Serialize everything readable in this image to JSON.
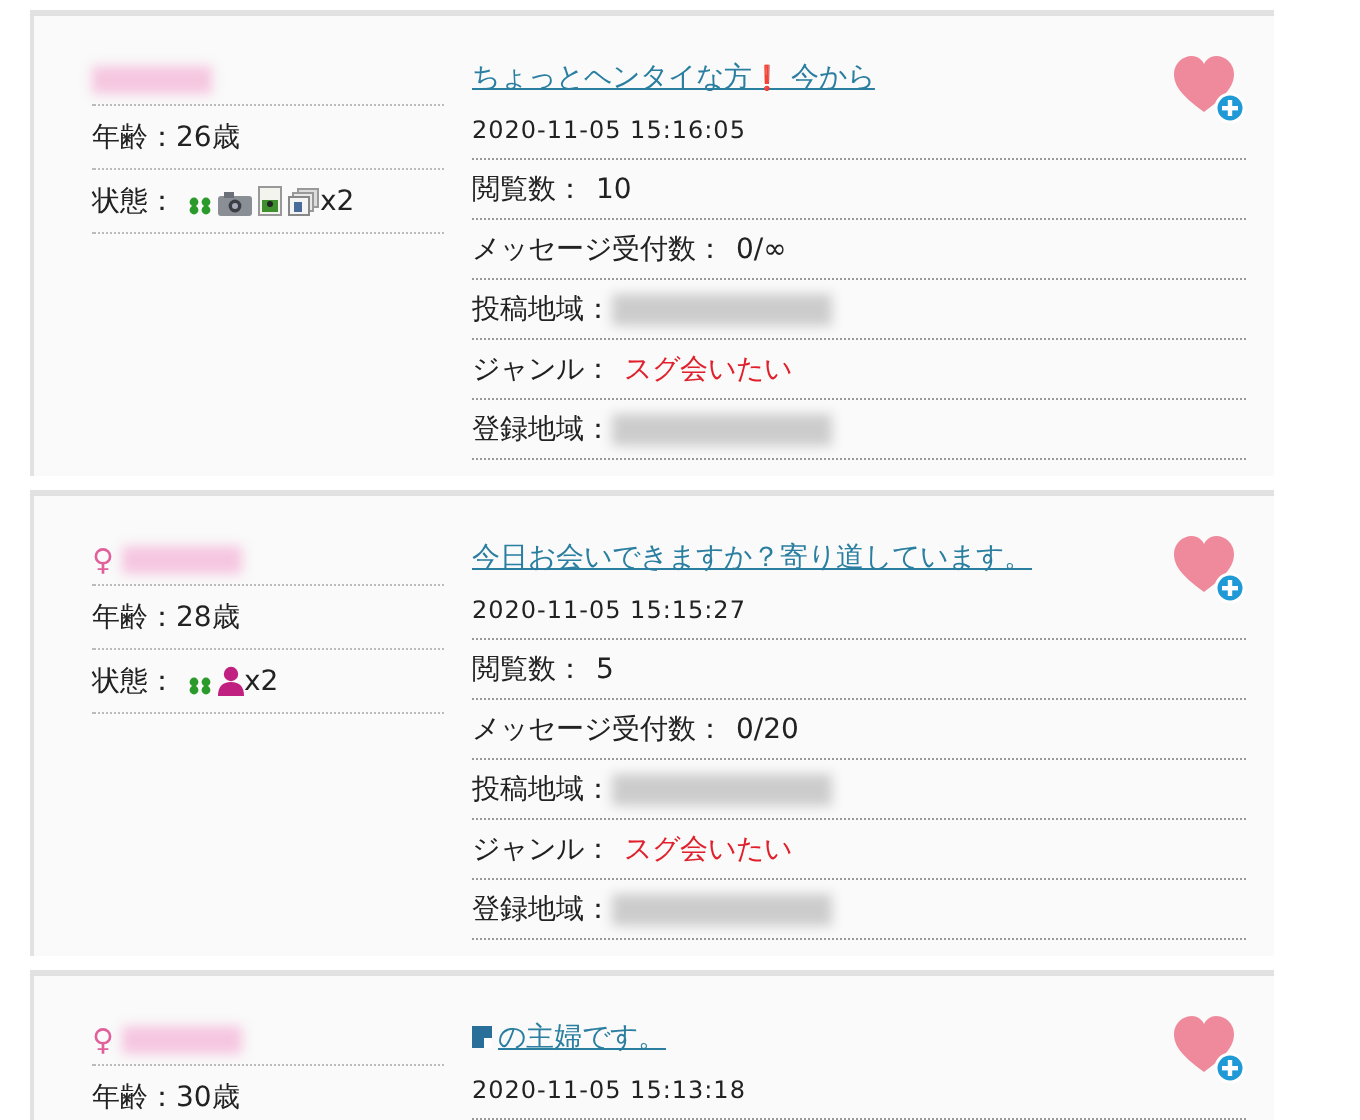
{
  "posts": [
    {
      "title": "ちょっとヘンタイな方",
      "title_mark": "❗",
      "title_suffix": "今から",
      "time": "2020-11-05 15:16:05",
      "age_label": "年齢：",
      "age": "26歳",
      "status_label": "状態：",
      "status_icons": [
        {
          "kind": "clover"
        },
        {
          "kind": "camera"
        },
        {
          "kind": "photo"
        },
        {
          "kind": "photos"
        }
      ],
      "status_count": "x2",
      "rows": [
        {
          "label": "閲覧数：",
          "value": "10",
          "kind": "text"
        },
        {
          "label": "メッセージ受付数：",
          "value": "0/∞",
          "kind": "text"
        },
        {
          "label": "投稿地域：",
          "kind": "blurred"
        },
        {
          "label": "ジャンル：",
          "value": "スグ会いたい",
          "kind": "genre"
        },
        {
          "label": "登録地域：",
          "kind": "blurred"
        }
      ]
    },
    {
      "gender": "♀",
      "title": "今日お会いできますか？寄り道しています。",
      "time": "2020-11-05 15:15:27",
      "age_label": "年齢：",
      "age": "28歳",
      "status_label": "状態：",
      "status_icons": [
        {
          "kind": "clover"
        },
        {
          "kind": "person"
        }
      ],
      "status_count": "x2",
      "rows": [
        {
          "label": "閲覧数：",
          "value": "5",
          "kind": "text"
        },
        {
          "label": "メッセージ受付数：",
          "value": "0/20",
          "kind": "text"
        },
        {
          "label": "投稿地域：",
          "kind": "blurred"
        },
        {
          "label": "ジャンル：",
          "value": "スグ会いたい",
          "kind": "genre"
        },
        {
          "label": "登録地域：",
          "kind": "blurred"
        }
      ]
    },
    {
      "gender": "♀",
      "title": "の主婦です。",
      "title_icon": true,
      "time": "2020-11-05 15:13:18",
      "age_label": "年齢：",
      "age": "30歳"
    }
  ]
}
